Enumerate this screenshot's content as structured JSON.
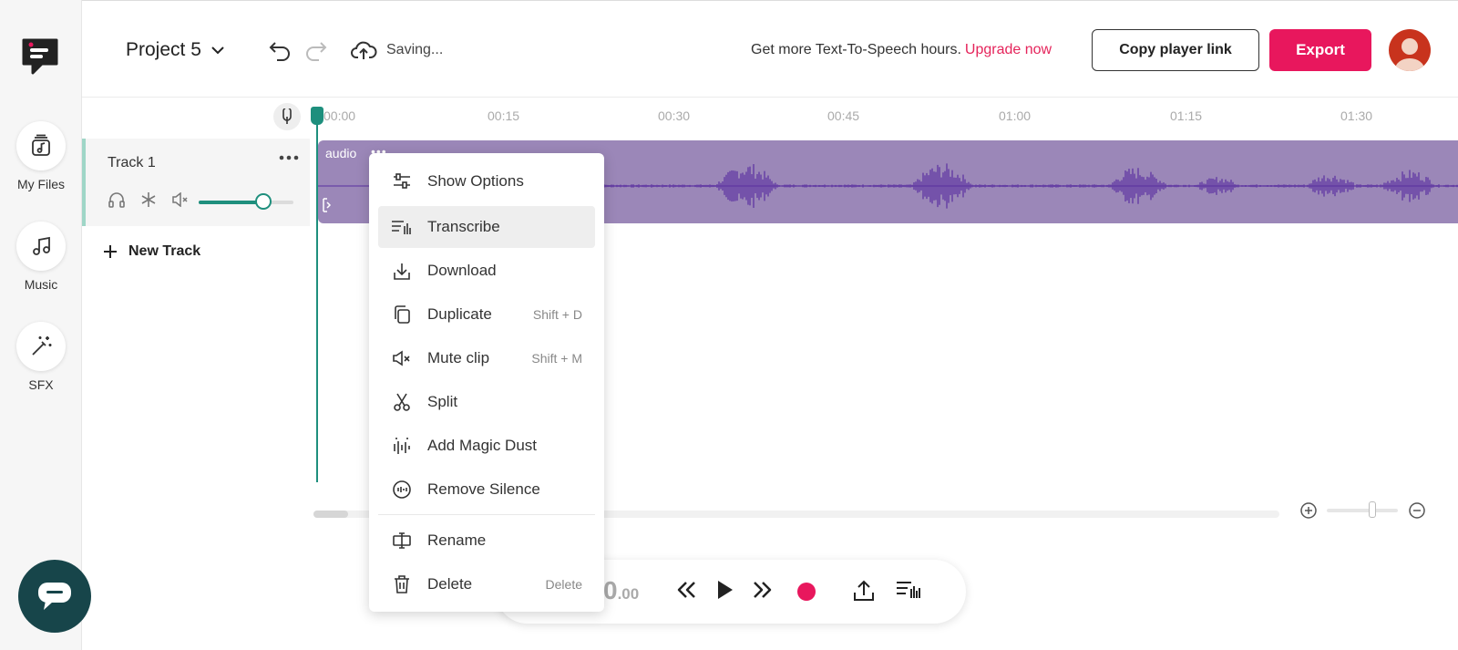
{
  "sidebar": {
    "items": [
      {
        "label": "My Files",
        "icon": "music-files-icon"
      },
      {
        "label": "Music",
        "icon": "music-note-icon"
      },
      {
        "label": "SFX",
        "icon": "magic-wand-icon"
      }
    ]
  },
  "header": {
    "project_name": "Project 5",
    "save_status": "Saving...",
    "promo_text": "Get more Text-To-Speech hours.",
    "upgrade_link": "Upgrade now",
    "copy_link_label": "Copy player link",
    "export_label": "Export"
  },
  "timeline": {
    "ticks": [
      "00:00",
      "00:15",
      "00:30",
      "00:45",
      "01:00",
      "01:15",
      "01:30"
    ]
  },
  "track": {
    "name": "Track 1",
    "volume": 0.68,
    "new_track_label": "New Track"
  },
  "clip": {
    "label": "audio",
    "dots": "•••"
  },
  "player": {
    "time_main": "0",
    "time_fraction": ".00"
  },
  "context_menu": {
    "items": [
      {
        "label": "Show Options",
        "shortcut": "",
        "icon": "sliders-icon"
      },
      {
        "label": "Transcribe",
        "shortcut": "",
        "icon": "transcribe-icon"
      },
      {
        "label": "Download",
        "shortcut": "",
        "icon": "download-icon"
      },
      {
        "label": "Duplicate",
        "shortcut": "Shift + D",
        "icon": "duplicate-icon"
      },
      {
        "label": "Mute clip",
        "shortcut": "Shift + M",
        "icon": "mute-icon"
      },
      {
        "label": "Split",
        "shortcut": "",
        "icon": "scissors-icon"
      },
      {
        "label": "Add Magic Dust",
        "shortcut": "",
        "icon": "magic-dust-icon"
      },
      {
        "label": "Remove Silence",
        "shortcut": "",
        "icon": "remove-silence-icon"
      },
      {
        "label": "Rename",
        "shortcut": "",
        "icon": "rename-icon"
      },
      {
        "label": "Delete",
        "shortcut": "Delete",
        "icon": "trash-icon"
      }
    ]
  },
  "colors": {
    "accent": "#e8175d",
    "teal": "#1e8f7d",
    "clip": "#9b87b8",
    "waveform": "#5a2fa0"
  }
}
